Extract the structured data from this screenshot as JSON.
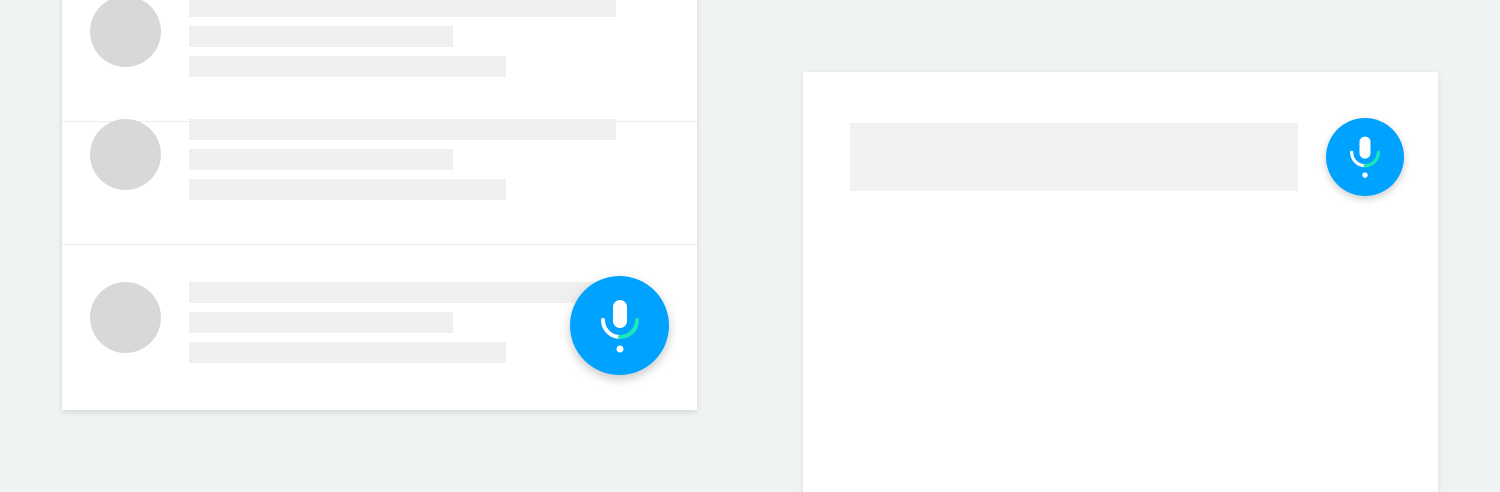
{
  "colors": {
    "page_background": "#f0f3f4",
    "card_background": "#ffffff",
    "skeleton_placeholder": "#efefef",
    "avatar_placeholder": "#d8d8d8",
    "search_field_background": "#f2f2f2",
    "accent_blue": "#00a2ff",
    "mic_level_green": "#1de9b6",
    "mic_icon_white": "#ffffff"
  },
  "list": {
    "rows": [
      {
        "state": "loading"
      },
      {
        "state": "loading"
      },
      {
        "state": "loading"
      }
    ]
  },
  "voice_buttons": {
    "list_icon": "microphone-icon",
    "search_icon": "microphone-icon"
  },
  "search": {
    "value": "",
    "placeholder": ""
  }
}
